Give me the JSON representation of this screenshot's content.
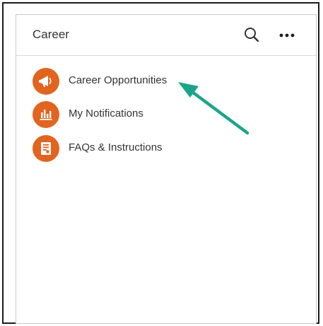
{
  "card": {
    "title": "Career"
  },
  "header": {
    "search_icon": "search-icon",
    "more_icon": "more-horizontal-icon"
  },
  "items": [
    {
      "label": "Career Opportunities",
      "icon": "megaphone-icon"
    },
    {
      "label": "My Notifications",
      "icon": "bar-chart-icon"
    },
    {
      "label": "FAQs & Instructions",
      "icon": "document-icon"
    }
  ],
  "colors": {
    "icon_accent": "#e1641f",
    "annotation_arrow": "#1aa58a"
  }
}
